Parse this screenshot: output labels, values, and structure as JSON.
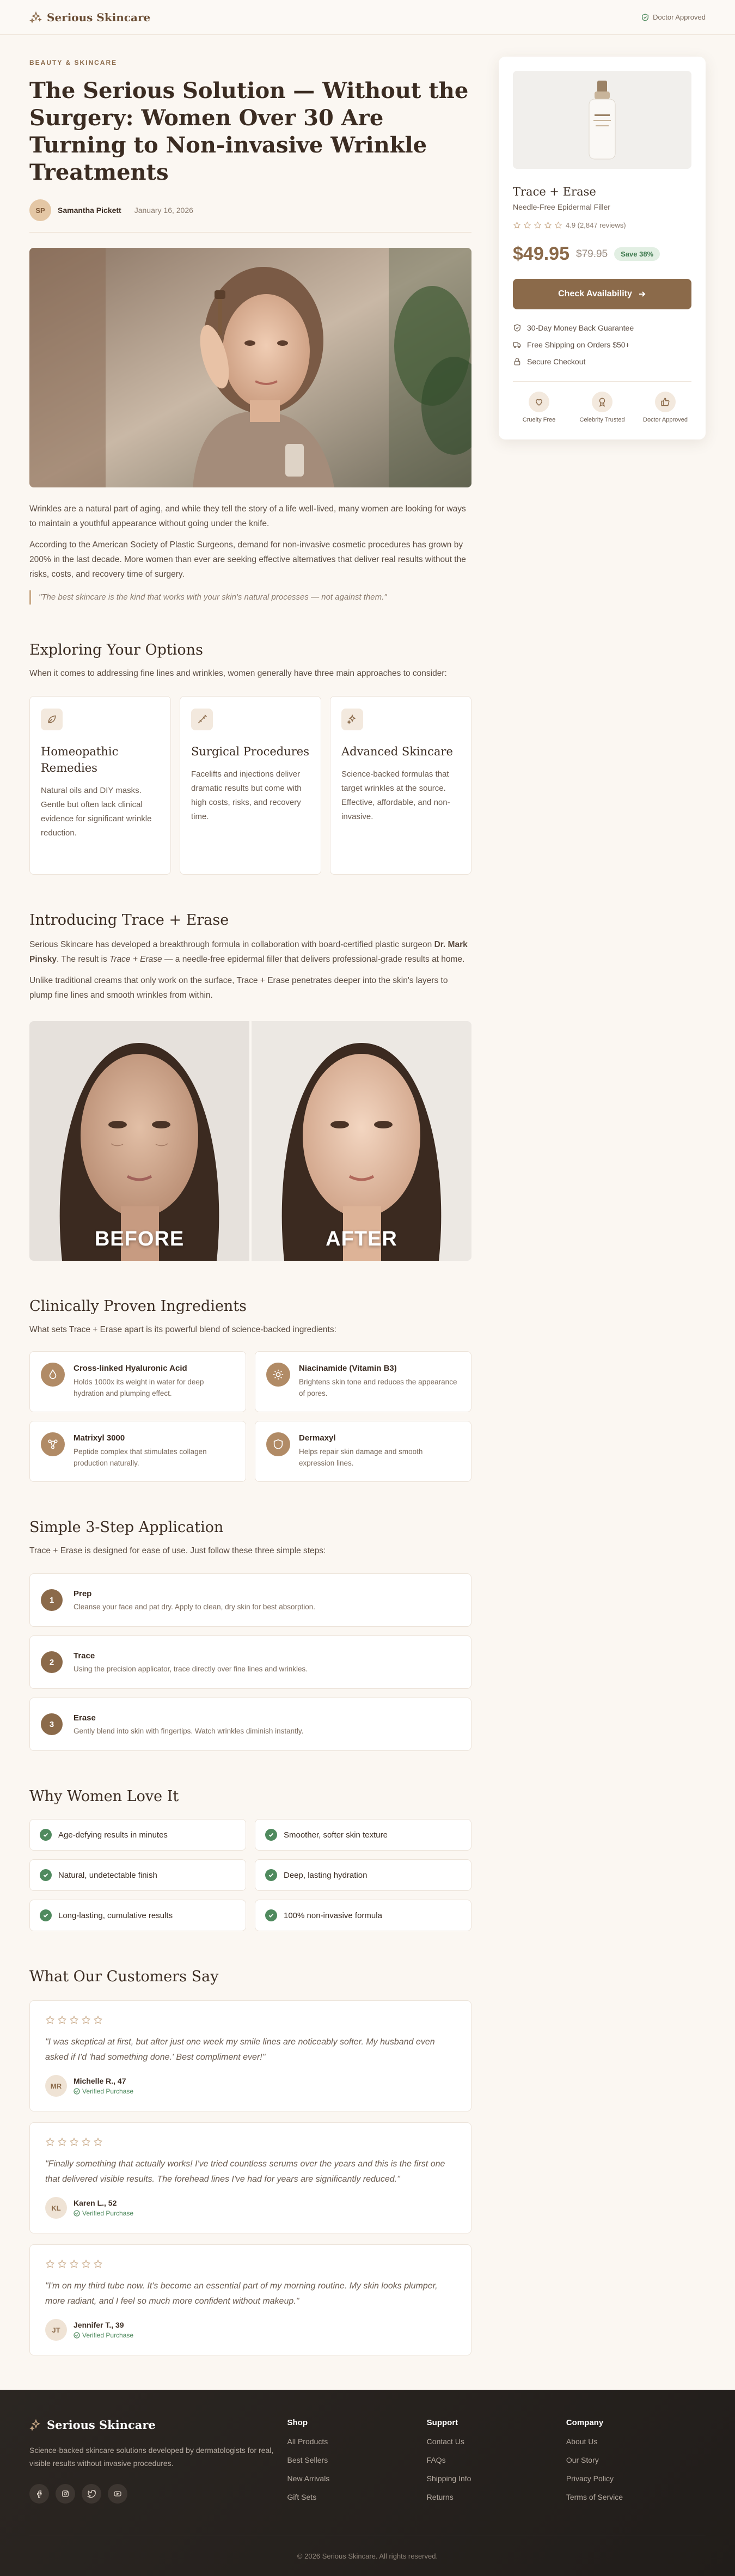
{
  "header": {
    "brand": "Serious Skincare",
    "approved_label": "Doctor Approved"
  },
  "article": {
    "eyebrow": "BEAUTY & SKINCARE",
    "title": "The Serious Solution — Without the Surgery: Women Over 30 Are Turning to Non-invasive Wrinkle Treatments",
    "author_initials": "SP",
    "author": "Samantha Pickett",
    "date": "January 16, 2026",
    "p1": "Wrinkles are a natural part of aging, and while they tell the story of a life well-lived, many women are looking for ways to maintain a youthful appearance without going under the knife.",
    "p2": "According to the American Society of Plastic Surgeons, demand for non-invasive cosmetic procedures has grown by 200% in the last decade. More women than ever are seeking effective alternatives that deliver real results without the risks, costs, and recovery time of surgery.",
    "quote": "\"The best skincare is the kind that works with your skin's natural processes — not against them.\""
  },
  "options": {
    "title": "Exploring Your Options",
    "intro": "When it comes to addressing fine lines and wrinkles, women generally have three main approaches to consider:",
    "cards": [
      {
        "icon": "leaf-icon",
        "title": "Homeopathic Remedies",
        "text": "Natural oils and DIY masks. Gentle but often lack clinical evidence for significant wrinkle reduction."
      },
      {
        "icon": "syringe-icon",
        "title": "Surgical Procedures",
        "text": "Facelifts and injections deliver dramatic results but come with high costs, risks, and recovery time."
      },
      {
        "icon": "sparkles-icon",
        "title": "Advanced Skincare",
        "text": "Science-backed formulas that target wrinkles at the source. Effective, affordable, and non-invasive."
      }
    ]
  },
  "intro_product": {
    "title": "Introducing Trace + Erase",
    "p1_a": "Serious Skincare has developed a breakthrough formula in collaboration with board-certified plastic surgeon ",
    "p1_doctor": "Dr. Mark Pinsky",
    "p1_b": ". The result is ",
    "p1_product": "Trace + Erase",
    "p1_c": " — a needle-free epidermal filler that delivers professional-grade results at home.",
    "p2": "Unlike traditional creams that only work on the surface, Trace + Erase penetrates deeper into the skin's layers to plump fine lines and smooth wrinkles from within.",
    "before_label": "BEFORE",
    "after_label": "AFTER"
  },
  "ingredients": {
    "title": "Clinically Proven Ingredients",
    "intro": "What sets Trace + Erase apart is its powerful blend of science-backed ingredients:",
    "items": [
      {
        "icon": "droplet-icon",
        "name": "Cross-linked Hyaluronic Acid",
        "text": "Holds 1000x its weight in water for deep hydration and plumping effect."
      },
      {
        "icon": "sun-icon",
        "name": "Niacinamide (Vitamin B3)",
        "text": "Brightens skin tone and reduces the appearance of pores."
      },
      {
        "icon": "molecule-icon",
        "name": "Matrixyl 3000",
        "text": "Peptide complex that stimulates collagen production naturally."
      },
      {
        "icon": "shield-icon",
        "name": "Dermaxyl",
        "text": "Helps repair skin damage and smooth expression lines."
      }
    ]
  },
  "steps": {
    "title": "Simple 3-Step Application",
    "intro": "Trace + Erase is designed for ease of use. Just follow these three simple steps:",
    "items": [
      {
        "num": "1",
        "title": "Prep",
        "text": "Cleanse your face and pat dry. Apply to clean, dry skin for best absorption."
      },
      {
        "num": "2",
        "title": "Trace",
        "text": "Using the precision applicator, trace directly over fine lines and wrinkles."
      },
      {
        "num": "3",
        "title": "Erase",
        "text": "Gently blend into skin with fingertips. Watch wrinkles diminish instantly."
      }
    ]
  },
  "love": {
    "title": "Why Women Love It",
    "items": [
      "Age-defying results in minutes",
      "Smoother, softer skin texture",
      "Natural, undetectable finish",
      "Deep, lasting hydration",
      "Long-lasting, cumulative results",
      "100% non-invasive formula"
    ]
  },
  "reviews": {
    "title": "What Our Customers Say",
    "verified_label": "Verified Purchase",
    "items": [
      {
        "initials": "MR",
        "name": "Michelle R., 47",
        "text": "\"I was skeptical at first, but after just one week my smile lines are noticeably softer. My husband even asked if I'd 'had something done.' Best compliment ever!\""
      },
      {
        "initials": "KL",
        "name": "Karen L., 52",
        "text": "\"Finally something that actually works! I've tried countless serums over the years and this is the first one that delivered visible results. The forehead lines I've had for years are significantly reduced.\""
      },
      {
        "initials": "JT",
        "name": "Jennifer T., 39",
        "text": "\"I'm on my third tube now. It's become an essential part of my morning routine. My skin looks plumper, more radiant, and I feel so much more confident without makeup.\""
      }
    ]
  },
  "product_card": {
    "name": "Trace + Erase",
    "subtitle": "Needle-Free Epidermal Filler",
    "rating_text": "4.9 (2,847 reviews)",
    "price": "$49.95",
    "old_price": "$79.95",
    "save": "Save 38%",
    "cta": "Check Availability",
    "perks": [
      {
        "icon": "shield-check-icon",
        "text": "30-Day Money Back Guarantee"
      },
      {
        "icon": "truck-icon",
        "text": "Free Shipping on Orders $50+"
      },
      {
        "icon": "lock-icon",
        "text": "Secure Checkout"
      }
    ],
    "badges": [
      {
        "icon": "heart-icon",
        "label": "Cruelty Free"
      },
      {
        "icon": "star-badge-icon",
        "label": "Celebrity Trusted"
      },
      {
        "icon": "thumbs-up-icon",
        "label": "Doctor Approved"
      }
    ]
  },
  "footer": {
    "brand": "Serious Skincare",
    "desc": "Science-backed skincare solutions developed by dermatologists for real, visible results without invasive procedures.",
    "socials": [
      "facebook-icon",
      "instagram-icon",
      "twitter-icon",
      "youtube-icon"
    ],
    "columns": [
      {
        "title": "Shop",
        "links": [
          "All Products",
          "Best Sellers",
          "New Arrivals",
          "Gift Sets"
        ]
      },
      {
        "title": "Support",
        "links": [
          "Contact Us",
          "FAQs",
          "Shipping Info",
          "Returns"
        ]
      },
      {
        "title": "Company",
        "links": [
          "About Us",
          "Our Story",
          "Privacy Policy",
          "Terms of Service"
        ]
      }
    ],
    "copyright": "© 2026 Serious Skincare. All rights reserved."
  },
  "colors": {
    "accent": "#8b6a4a",
    "background": "#fbf7f2",
    "success": "#4f8a5e",
    "footer": "#2b2622"
  }
}
